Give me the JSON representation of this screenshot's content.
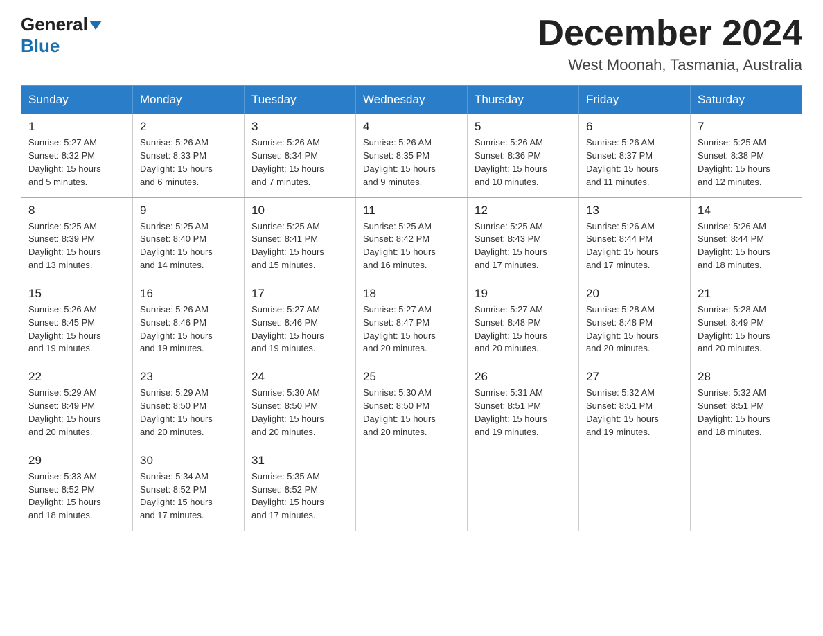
{
  "logo": {
    "general_text": "General",
    "blue_text": "Blue"
  },
  "title": {
    "month_year": "December 2024",
    "location": "West Moonah, Tasmania, Australia"
  },
  "headers": [
    "Sunday",
    "Monday",
    "Tuesday",
    "Wednesday",
    "Thursday",
    "Friday",
    "Saturday"
  ],
  "weeks": [
    [
      {
        "day": "1",
        "sunrise": "5:27 AM",
        "sunset": "8:32 PM",
        "daylight": "15 hours and 5 minutes."
      },
      {
        "day": "2",
        "sunrise": "5:26 AM",
        "sunset": "8:33 PM",
        "daylight": "15 hours and 6 minutes."
      },
      {
        "day": "3",
        "sunrise": "5:26 AM",
        "sunset": "8:34 PM",
        "daylight": "15 hours and 7 minutes."
      },
      {
        "day": "4",
        "sunrise": "5:26 AM",
        "sunset": "8:35 PM",
        "daylight": "15 hours and 9 minutes."
      },
      {
        "day": "5",
        "sunrise": "5:26 AM",
        "sunset": "8:36 PM",
        "daylight": "15 hours and 10 minutes."
      },
      {
        "day": "6",
        "sunrise": "5:26 AM",
        "sunset": "8:37 PM",
        "daylight": "15 hours and 11 minutes."
      },
      {
        "day": "7",
        "sunrise": "5:25 AM",
        "sunset": "8:38 PM",
        "daylight": "15 hours and 12 minutes."
      }
    ],
    [
      {
        "day": "8",
        "sunrise": "5:25 AM",
        "sunset": "8:39 PM",
        "daylight": "15 hours and 13 minutes."
      },
      {
        "day": "9",
        "sunrise": "5:25 AM",
        "sunset": "8:40 PM",
        "daylight": "15 hours and 14 minutes."
      },
      {
        "day": "10",
        "sunrise": "5:25 AM",
        "sunset": "8:41 PM",
        "daylight": "15 hours and 15 minutes."
      },
      {
        "day": "11",
        "sunrise": "5:25 AM",
        "sunset": "8:42 PM",
        "daylight": "15 hours and 16 minutes."
      },
      {
        "day": "12",
        "sunrise": "5:25 AM",
        "sunset": "8:43 PM",
        "daylight": "15 hours and 17 minutes."
      },
      {
        "day": "13",
        "sunrise": "5:26 AM",
        "sunset": "8:44 PM",
        "daylight": "15 hours and 17 minutes."
      },
      {
        "day": "14",
        "sunrise": "5:26 AM",
        "sunset": "8:44 PM",
        "daylight": "15 hours and 18 minutes."
      }
    ],
    [
      {
        "day": "15",
        "sunrise": "5:26 AM",
        "sunset": "8:45 PM",
        "daylight": "15 hours and 19 minutes."
      },
      {
        "day": "16",
        "sunrise": "5:26 AM",
        "sunset": "8:46 PM",
        "daylight": "15 hours and 19 minutes."
      },
      {
        "day": "17",
        "sunrise": "5:27 AM",
        "sunset": "8:46 PM",
        "daylight": "15 hours and 19 minutes."
      },
      {
        "day": "18",
        "sunrise": "5:27 AM",
        "sunset": "8:47 PM",
        "daylight": "15 hours and 20 minutes."
      },
      {
        "day": "19",
        "sunrise": "5:27 AM",
        "sunset": "8:48 PM",
        "daylight": "15 hours and 20 minutes."
      },
      {
        "day": "20",
        "sunrise": "5:28 AM",
        "sunset": "8:48 PM",
        "daylight": "15 hours and 20 minutes."
      },
      {
        "day": "21",
        "sunrise": "5:28 AM",
        "sunset": "8:49 PM",
        "daylight": "15 hours and 20 minutes."
      }
    ],
    [
      {
        "day": "22",
        "sunrise": "5:29 AM",
        "sunset": "8:49 PM",
        "daylight": "15 hours and 20 minutes."
      },
      {
        "day": "23",
        "sunrise": "5:29 AM",
        "sunset": "8:50 PM",
        "daylight": "15 hours and 20 minutes."
      },
      {
        "day": "24",
        "sunrise": "5:30 AM",
        "sunset": "8:50 PM",
        "daylight": "15 hours and 20 minutes."
      },
      {
        "day": "25",
        "sunrise": "5:30 AM",
        "sunset": "8:50 PM",
        "daylight": "15 hours and 20 minutes."
      },
      {
        "day": "26",
        "sunrise": "5:31 AM",
        "sunset": "8:51 PM",
        "daylight": "15 hours and 19 minutes."
      },
      {
        "day": "27",
        "sunrise": "5:32 AM",
        "sunset": "8:51 PM",
        "daylight": "15 hours and 19 minutes."
      },
      {
        "day": "28",
        "sunrise": "5:32 AM",
        "sunset": "8:51 PM",
        "daylight": "15 hours and 18 minutes."
      }
    ],
    [
      {
        "day": "29",
        "sunrise": "5:33 AM",
        "sunset": "8:52 PM",
        "daylight": "15 hours and 18 minutes."
      },
      {
        "day": "30",
        "sunrise": "5:34 AM",
        "sunset": "8:52 PM",
        "daylight": "15 hours and 17 minutes."
      },
      {
        "day": "31",
        "sunrise": "5:35 AM",
        "sunset": "8:52 PM",
        "daylight": "15 hours and 17 minutes."
      },
      null,
      null,
      null,
      null
    ]
  ],
  "labels": {
    "sunrise": "Sunrise:",
    "sunset": "Sunset:",
    "daylight": "Daylight:"
  }
}
